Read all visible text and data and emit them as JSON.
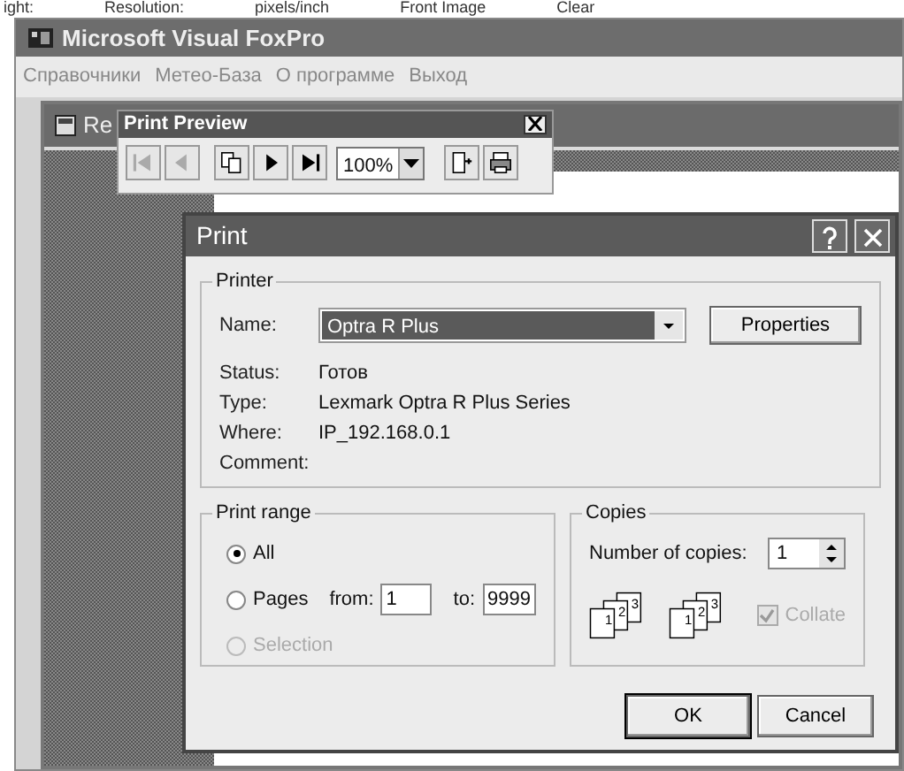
{
  "background_strip": {
    "labels": [
      "ight:",
      "Resolution:",
      "pixels/inch",
      "Front Image",
      "Clear"
    ]
  },
  "main_window": {
    "title": "Microsoft Visual FoxPro",
    "menu": [
      "Справочники",
      "Метео-База",
      "О программе",
      "Выход"
    ]
  },
  "report_window": {
    "title": "Re"
  },
  "preview_toolbar": {
    "title": "Print Preview",
    "zoom": "100%",
    "buttons": [
      {
        "kind": "first",
        "disabled": true
      },
      {
        "kind": "prev",
        "disabled": true
      },
      {
        "kind": "pages",
        "disabled": false
      },
      {
        "kind": "next",
        "disabled": false
      },
      {
        "kind": "last",
        "disabled": false
      },
      {
        "kind": "zoom"
      },
      {
        "kind": "close",
        "disabled": false
      },
      {
        "kind": "print",
        "disabled": false
      }
    ]
  },
  "print_dialog": {
    "title": "Print",
    "printer": {
      "group": "Printer",
      "name_label": "Name:",
      "name": "Optra R Plus",
      "properties": "Properties",
      "info": [
        {
          "label": "Status:",
          "value": "Готов"
        },
        {
          "label": "Type:",
          "value": "Lexmark Optra R Plus Series"
        },
        {
          "label": "Where:",
          "value": "IP_192.168.0.1"
        },
        {
          "label": "Comment:"
        }
      ]
    },
    "range": {
      "group": "Print range",
      "options": [
        {
          "label": "All",
          "selected": true,
          "disabled": false
        },
        {
          "label": "Pages",
          "selected": false,
          "disabled": false
        },
        {
          "label": "Selection",
          "selected": false,
          "disabled": true
        }
      ],
      "from_label": "from:",
      "from": "1",
      "to_label": "to:",
      "to": "9999"
    },
    "copies": {
      "group": "Copies",
      "label": "Number of copies:",
      "value": "1",
      "stacks": [
        [
          "1",
          "2",
          "3"
        ],
        [
          "1",
          "2",
          "3"
        ]
      ],
      "collate": {
        "label": "Collate",
        "checked": true,
        "disabled": true
      }
    },
    "buttons": [
      "OK",
      "Cancel"
    ]
  }
}
